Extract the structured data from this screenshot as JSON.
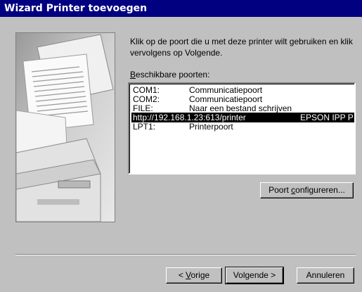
{
  "window": {
    "title": "Wizard Printer toevoegen"
  },
  "intro_text": "Klik op de poort die u met deze printer wilt gebruiken en klik vervolgens op Volgende.",
  "ports_label": {
    "accel": "B",
    "rest": "eschikbare poorten:"
  },
  "ports": [
    {
      "name": "COM1:",
      "description": "Communicatiepoort",
      "extra": ""
    },
    {
      "name": "COM2:",
      "description": "Communicatiepoort",
      "extra": ""
    },
    {
      "name": "FILE:",
      "description": "Naar een bestand schrijven",
      "extra": ""
    },
    {
      "name": "http://192.168.1.23:613/printer",
      "description": "",
      "extra": "EPSON IPP P"
    },
    {
      "name": "LPT1:",
      "description": "Printerpoort",
      "extra": ""
    }
  ],
  "selected_port_index": 3,
  "buttons": {
    "configure": {
      "pre": "Poort ",
      "accel": "c",
      "post": "onfigureren..."
    },
    "back": {
      "pre": "< ",
      "accel": "V",
      "post": "orige"
    },
    "next": {
      "label": "Volgende >"
    },
    "cancel": {
      "label": "Annuleren"
    }
  },
  "colors": {
    "titlebar": "#000080",
    "face": "#c0c0c0",
    "selection": "#000000"
  }
}
